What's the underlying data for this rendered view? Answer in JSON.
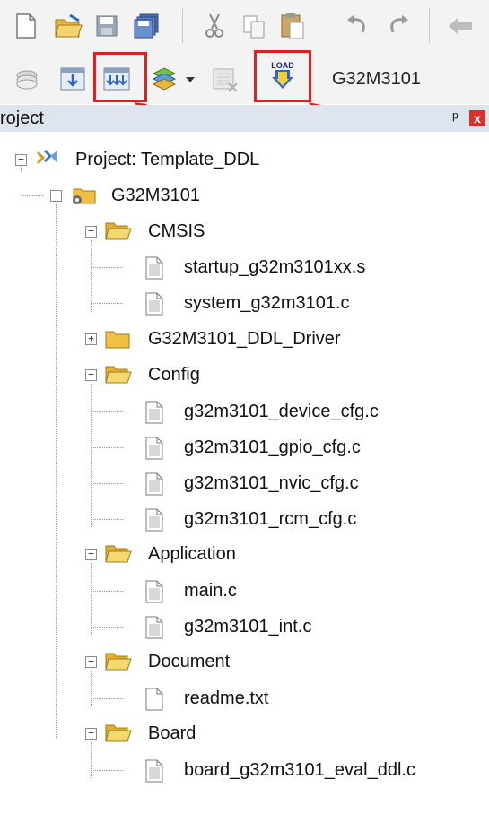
{
  "toolbar": {
    "target_name": "G32M3101",
    "load_icon_text": "LOAD"
  },
  "project_panel": {
    "title": "roject",
    "pin_glyph": "ᵖ",
    "close_glyph": "x"
  },
  "tree": {
    "root": "Project: Template_DDL",
    "target": "G32M3101",
    "groups": [
      {
        "name": "CMSIS",
        "files": [
          "startup_g32m3101xx.s",
          "system_g32m3101.c"
        ]
      },
      {
        "name": "G32M3101_DDL_Driver",
        "files": []
      },
      {
        "name": "Config",
        "files": [
          "g32m3101_device_cfg.c",
          "g32m3101_gpio_cfg.c",
          "g32m3101_nvic_cfg.c",
          "g32m3101_rcm_cfg.c"
        ]
      },
      {
        "name": "Application",
        "files": [
          "main.c",
          "g32m3101_int.c"
        ]
      },
      {
        "name": "Document",
        "files": [
          "readme.txt"
        ]
      },
      {
        "name": "Board",
        "files": [
          "board_g32m3101_eval_ddl.c"
        ]
      }
    ]
  },
  "colors": {
    "highlight": "#e02020",
    "folder": "#f0c040"
  }
}
